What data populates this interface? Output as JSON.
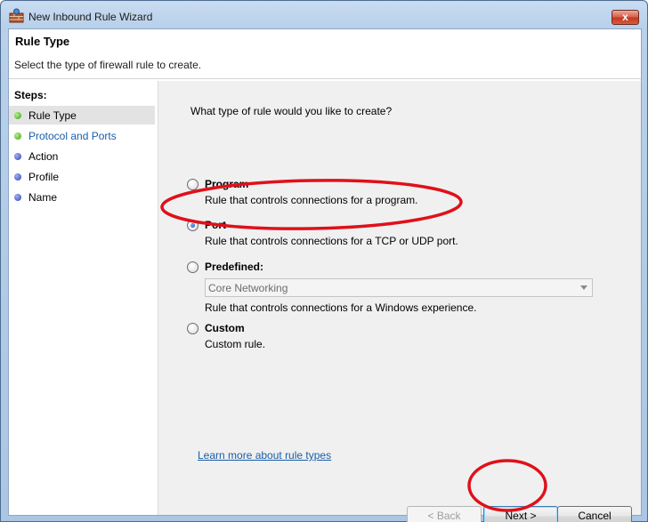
{
  "window": {
    "title": "New Inbound Rule Wizard",
    "close_glyph": "x"
  },
  "header": {
    "title": "Rule Type",
    "subtitle": "Select the type of firewall rule to create."
  },
  "steps": {
    "heading": "Steps:",
    "items": [
      {
        "label": "Rule Type",
        "status": "current"
      },
      {
        "label": "Protocol and Ports",
        "status": "link"
      },
      {
        "label": "Action",
        "status": "pending"
      },
      {
        "label": "Profile",
        "status": "pending"
      },
      {
        "label": "Name",
        "status": "pending"
      }
    ]
  },
  "main": {
    "question": "What type of rule would you like to create?",
    "options": [
      {
        "title": "Program",
        "description": "Rule that controls connections for a program.",
        "checked": false
      },
      {
        "title": "Port",
        "description": "Rule that controls connections for a TCP or UDP port.",
        "checked": true
      },
      {
        "title": "Predefined:",
        "description": "Rule that controls connections for a Windows experience.",
        "checked": false,
        "select_value": "Core Networking"
      },
      {
        "title": "Custom",
        "description": "Custom rule.",
        "checked": false
      }
    ],
    "learn_more": "Learn more about rule types"
  },
  "buttons": {
    "back": "< Back",
    "next": "Next >",
    "cancel": "Cancel"
  },
  "colors": {
    "annotation": "#e0101a",
    "link": "#1a5ea8",
    "step_done": "#3f9e1a",
    "step_pending": "#2f42b4"
  }
}
